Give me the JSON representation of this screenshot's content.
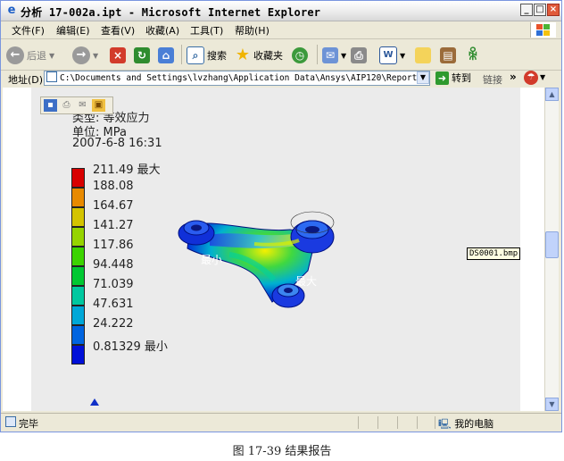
{
  "window": {
    "title": "分析 17-002a.ipt - Microsoft Internet Explorer"
  },
  "menu": {
    "items": [
      "文件(F)",
      "编辑(E)",
      "查看(V)",
      "收藏(A)",
      "工具(T)",
      "帮助(H)"
    ]
  },
  "toolbar": {
    "back_label": "后退",
    "search_label": "搜索",
    "favorites_label": "收藏夹"
  },
  "addressbar": {
    "label": "地址(D)",
    "url": "C:\\Documents and Settings\\lvzhang\\Application Data\\Ansys\\AIP120\\Report.htm",
    "go_label": "转到",
    "links_label": "链接"
  },
  "report": {
    "type_line": "类型: 等效应力",
    "unit_line": "单位: MPa",
    "date_line": "2007-6-8 16:31",
    "legend": [
      {
        "label": "211.49 最大",
        "color": "#d80000"
      },
      {
        "label": "188.08",
        "color": "#e88a00"
      },
      {
        "label": "164.67",
        "color": "#d4c400"
      },
      {
        "label": "141.27",
        "color": "#96d400"
      },
      {
        "label": "117.86",
        "color": "#3cd400"
      },
      {
        "label": "94.448",
        "color": "#00c832"
      },
      {
        "label": "71.039",
        "color": "#00c8a0"
      },
      {
        "label": "47.631",
        "color": "#00a8d8"
      },
      {
        "label": "24.222",
        "color": "#0064e0"
      },
      {
        "label": "0.81329 最小",
        "color": "#0010d8"
      }
    ],
    "min_tag": "最小",
    "max_tag": "最大",
    "image_filename": "DS0001.bmp"
  },
  "statusbar": {
    "status": "完毕",
    "zone": "我的电脑"
  },
  "caption": "图 17-39   结果报告"
}
